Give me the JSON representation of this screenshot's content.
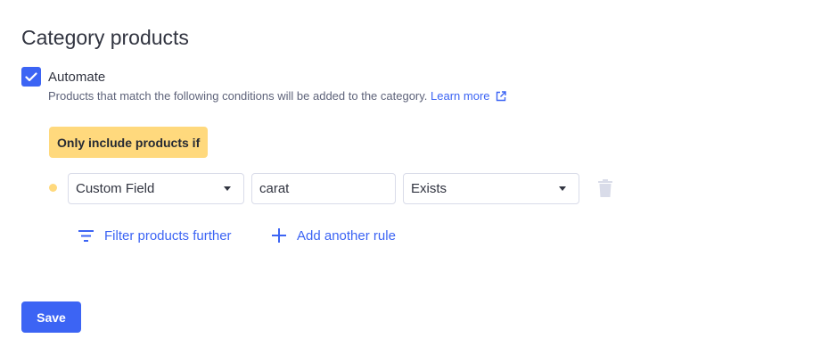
{
  "section": {
    "title": "Category products"
  },
  "automate": {
    "checked": true,
    "label": "Automate",
    "description": "Products that match the following conditions will be added to the category.",
    "learn_more": "Learn more",
    "learn_more_icon": "external-link-icon"
  },
  "rules": {
    "badge": "Only include products if",
    "rows": [
      {
        "field": "Custom Field",
        "value": "carat",
        "operator": "Exists",
        "delete_icon": "trash-icon"
      }
    ]
  },
  "actions": {
    "filter_label": "Filter products further",
    "filter_icon": "filter-icon",
    "add_rule_label": "Add another rule",
    "add_rule_icon": "plus-icon"
  },
  "footer": {
    "save_label": "Save"
  },
  "colors": {
    "accent": "#3c64f4",
    "badge_bg": "#ffd97d",
    "text": "#313440",
    "muted_text": "#5e637a",
    "disabled_icon": "#d9dce9"
  }
}
